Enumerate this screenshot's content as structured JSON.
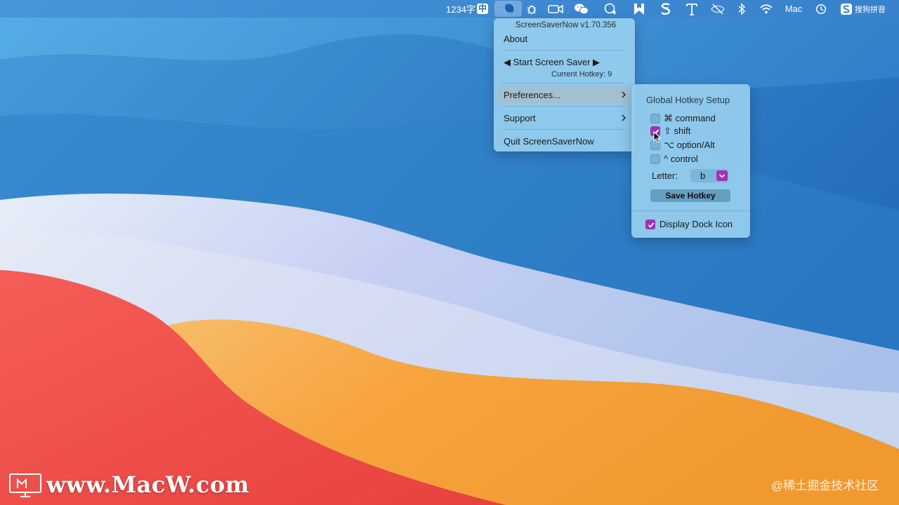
{
  "menubar": {
    "word_count": "1234字",
    "input_mode": "中",
    "user_label": "Mac",
    "sogou_label": "搜狗拼音",
    "icons": [
      "screensavernow-icon",
      "bug-icon",
      "video-camera-icon",
      "wechat-icon",
      "chat-bubble-icon",
      "bookmark-app-icon",
      "s-app-icon",
      "typeface-icon",
      "eye-slash-icon",
      "bluetooth-icon",
      "wifi-icon",
      "time-machine-icon",
      "sogou-icon"
    ]
  },
  "main_menu": {
    "version": "ScreenSaverNow v1.70.356",
    "about": "About",
    "start": "◀ Start Screen Saver ▶",
    "current_hotkey": "Current Hotkey: 9",
    "preferences": "Preferences...",
    "support": "Support",
    "quit": "Quit ScreenSaverNow"
  },
  "preferences_menu": {
    "title": "Global Hotkey Setup",
    "modifiers": [
      {
        "label": "⌘ command",
        "checked": false
      },
      {
        "label": "⇧ shift",
        "checked": true
      },
      {
        "label": "⌥ option/Alt",
        "checked": false
      },
      {
        "label": "^ control",
        "checked": false
      }
    ],
    "letter_label": "Letter:",
    "letter_value": "b",
    "save_button": "Save Hotkey",
    "dock_icon_label": "Display Dock Icon",
    "dock_icon_checked": true
  },
  "watermark": {
    "site": "www.MacW.com",
    "juejin": "@稀土掘金技术社区"
  },
  "colors": {
    "accent": "#a52fb3",
    "menubar": "#3c82cd",
    "menu_bg": "#96ceee"
  }
}
